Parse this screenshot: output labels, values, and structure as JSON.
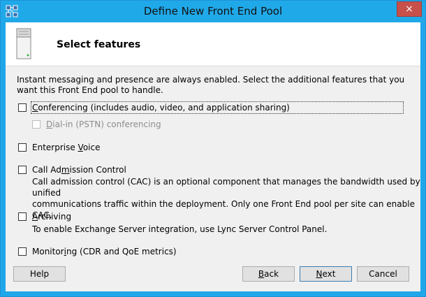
{
  "window": {
    "title": "Define New Front End Pool",
    "close_glyph": "×",
    "icon": "topology-builder-icon"
  },
  "header": {
    "title": "Select features",
    "icon": "server-icon"
  },
  "intro": "Instant messaging and presence are always enabled.  Select the additional features that you want this Front End pool to handle.",
  "options": {
    "conferencing": {
      "pre": "",
      "key": "C",
      "post": "onferencing (includes audio, video, and application sharing)",
      "checked": false
    },
    "dialin": {
      "pre": "",
      "key": "D",
      "post": "ial-in (PSTN) conferencing",
      "checked": false,
      "enabled": false
    },
    "enterprise_voice": {
      "pre": "Enterprise ",
      "key": "V",
      "post": "oice",
      "checked": false
    },
    "cac": {
      "pre": "Call Ad",
      "key": "m",
      "post": "ission Control",
      "checked": false
    },
    "archiving": {
      "pre": "",
      "key": "A",
      "post": "rchiving",
      "checked": false
    },
    "monitoring": {
      "pre": "Monitor",
      "key": "i",
      "post": "ng (CDR and QoE metrics)",
      "checked": false
    }
  },
  "descriptions": {
    "cac_line1": "Call admission control (CAC) is an optional component that manages the bandwidth used by unified",
    "cac_line2": "communications traffic within the deployment. Only one Front End pool per site can enable CAC.",
    "archiving": "To enable Exchange Server integration, use Lync Server Control Panel."
  },
  "buttons": {
    "help": "Help",
    "back": {
      "pre": "",
      "key": "B",
      "post": "ack"
    },
    "next": {
      "pre": "",
      "key": "N",
      "post": "ext"
    },
    "cancel": "Cancel"
  },
  "colors": {
    "titlebar": "#20a9e9",
    "close": "#c7504a",
    "dialog_bg": "#f0f0f0",
    "header_bg": "#ffffff"
  }
}
